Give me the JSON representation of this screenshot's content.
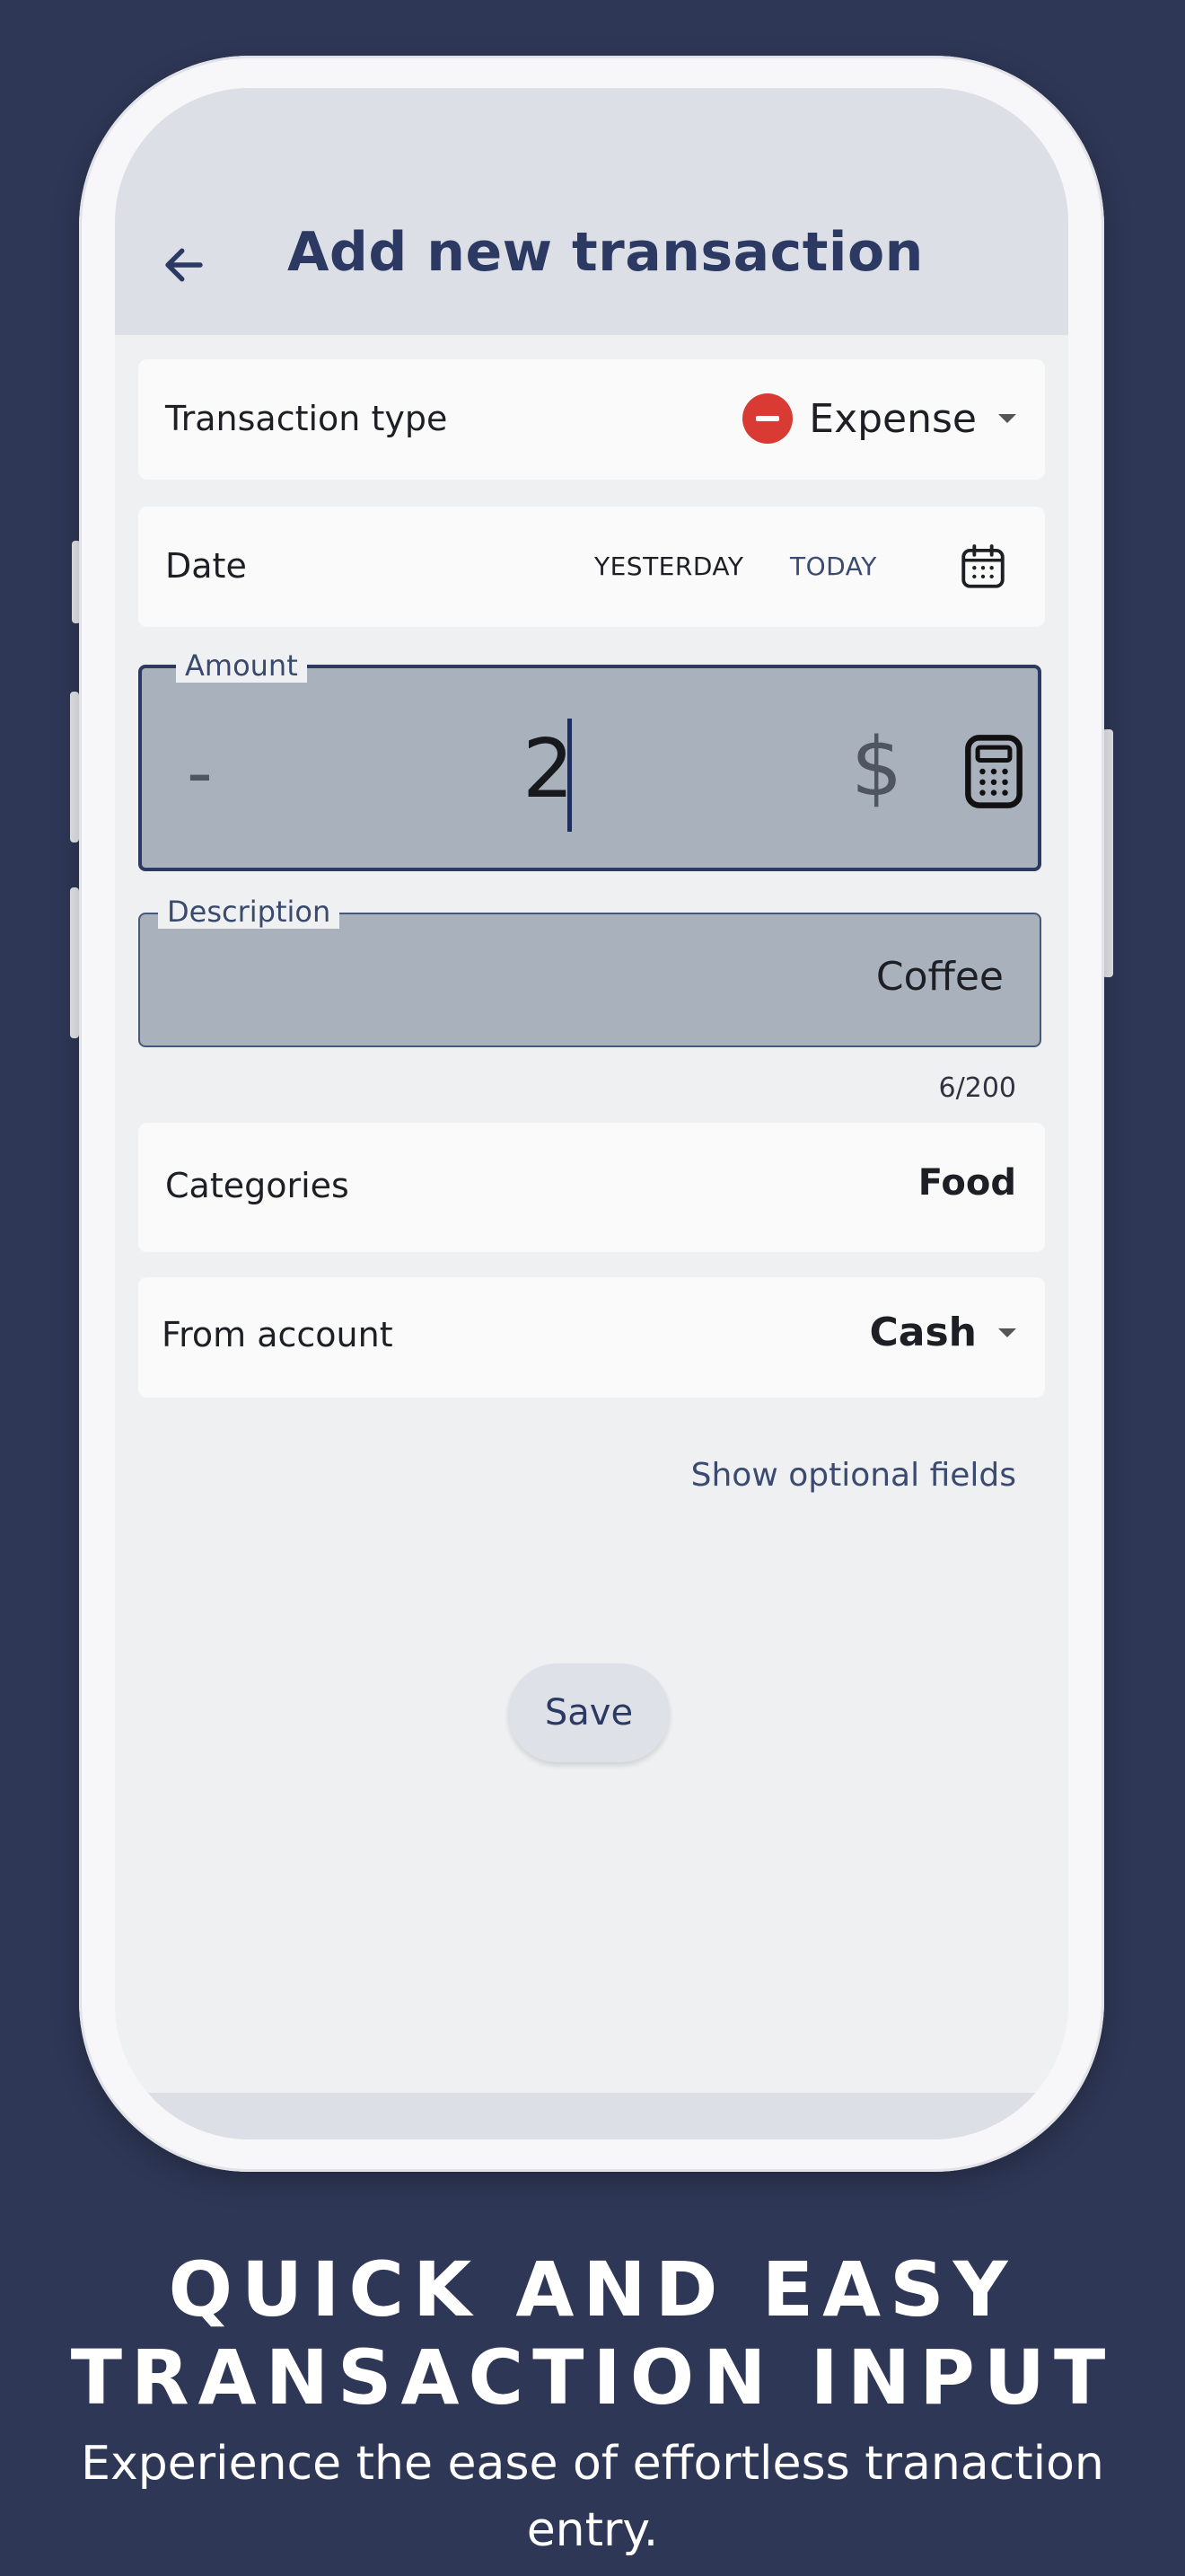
{
  "appbar": {
    "title": "Add new transaction",
    "back_icon": "arrow-left-icon"
  },
  "transaction_type": {
    "label": "Transaction type",
    "value": "Expense",
    "icon": "minus-circle-icon",
    "icon_color": "#d93a33"
  },
  "date": {
    "label": "Date",
    "yesterday_label": "YESTERDAY",
    "today_label": "TODAY",
    "calendar_icon": "calendar-icon"
  },
  "amount": {
    "legend": "Amount",
    "sign": "-",
    "value": "2",
    "currency": "$",
    "calculator_icon": "calculator-icon"
  },
  "description": {
    "legend": "Description",
    "value": "Coffee",
    "counter": "6/200"
  },
  "categories": {
    "label": "Categories",
    "value": "Food"
  },
  "from_account": {
    "label": "From account",
    "value": "Cash"
  },
  "optional_link": "Show optional fields",
  "save_label": "Save",
  "promo": {
    "headline_line1": "QUICK AND EASY",
    "headline_line2": "TRANSACTION INPUT",
    "subtitle": "Experience the ease of effortless tranaction entry."
  },
  "colors": {
    "background": "#2e3756",
    "accent": "#2c3a63",
    "expense_red": "#d93a33",
    "field_fill": "#a8b1bc"
  }
}
